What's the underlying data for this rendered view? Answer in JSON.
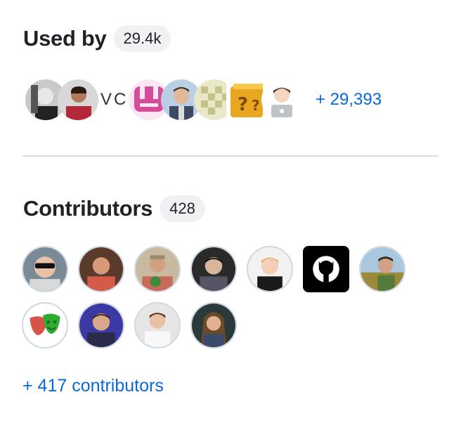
{
  "used_by": {
    "title": "Used by",
    "count": "29.4k",
    "vc_label": "VC",
    "more_label": "+ 29,393"
  },
  "contributors": {
    "title": "Contributors",
    "count": "428",
    "more_label": "+ 417 contributors"
  }
}
